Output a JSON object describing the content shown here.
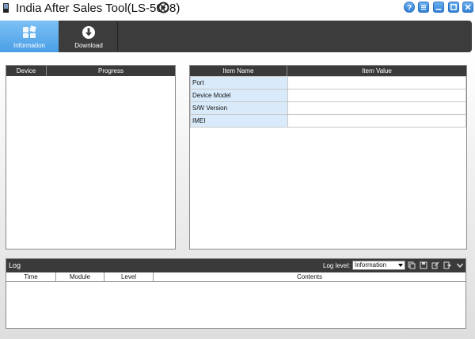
{
  "window": {
    "title": "India After Sales Tool(LS-5008)",
    "accent_color": "#3a8fe0",
    "buttons": [
      "help-icon",
      "menu-icon",
      "minimize-icon",
      "maximize-icon",
      "close-icon"
    ]
  },
  "toolbar": {
    "items": [
      {
        "label": "Information",
        "icon": "information-icon",
        "selected": true
      },
      {
        "label": "Download",
        "icon": "download-icon",
        "selected": false
      }
    ]
  },
  "device_panel": {
    "columns": [
      "Device",
      "Progress"
    ]
  },
  "info_panel": {
    "columns": [
      "Item Name",
      "Item Value"
    ],
    "rows": [
      {
        "name": "Port",
        "value": ""
      },
      {
        "name": "Device Model",
        "value": ""
      },
      {
        "name": "S/W Version",
        "value": ""
      },
      {
        "name": "IMEI",
        "value": ""
      }
    ]
  },
  "log": {
    "title": "Log",
    "level_label": "Log level:",
    "level_value": "Information",
    "columns": [
      "Time",
      "Module",
      "Level",
      "Contents"
    ]
  }
}
